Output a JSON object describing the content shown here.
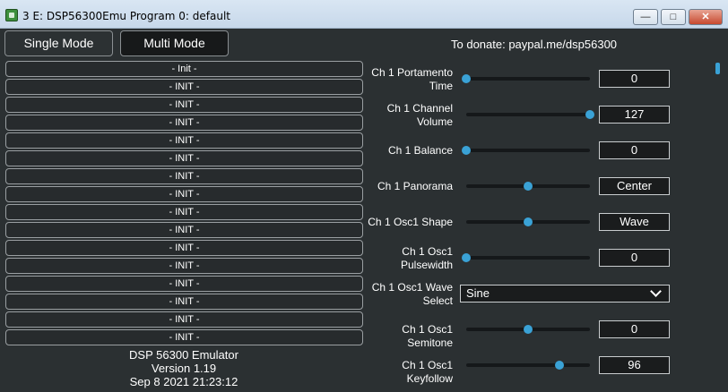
{
  "window": {
    "title": "3 E: DSP56300Emu Program 0: default",
    "minimize": "—",
    "maximize": "□",
    "close": "✕"
  },
  "modes": {
    "single": "Single Mode",
    "multi": "Multi Mode"
  },
  "donate": "To donate: paypal.me/dsp56300",
  "patches": [
    "- Init -",
    "- INIT -",
    "- INIT -",
    "- INIT -",
    "- INIT -",
    "- INIT -",
    "- INIT -",
    "- INIT -",
    "- INIT -",
    "- INIT -",
    "- INIT -",
    "- INIT -",
    "- INIT -",
    "- INIT -",
    "- INIT -",
    "- INIT -"
  ],
  "footer": {
    "name": "DSP 56300 Emulator",
    "version": "Version 1.19",
    "date": "Sep  8 2021 21:23:12"
  },
  "params": [
    {
      "label": "Ch 1 Portamento Time",
      "value": "0",
      "level": 0.0
    },
    {
      "label": "Ch 1 Channel Volume",
      "value": "127",
      "level": 1.0
    },
    {
      "label": "Ch 1 Balance",
      "value": "0",
      "level": 0.0
    },
    {
      "label": "Ch 1 Panorama",
      "value": "Center",
      "level": 0.5
    },
    {
      "label": "Ch 1 Osc1 Shape",
      "value": "Wave",
      "level": 0.5
    },
    {
      "label": "Ch 1 Osc1 Pulsewidth",
      "value": "0",
      "level": 0.0
    },
    {
      "label": "Ch 1 Osc1 Wave Select",
      "value": "Sine"
    },
    {
      "label": "Ch 1 Osc1 Semitone",
      "value": "0",
      "level": 0.5
    },
    {
      "label": "Ch 1 Osc1 Keyfollow",
      "value": "96",
      "level": 0.75
    }
  ],
  "colors": {
    "accent": "#3aa2d6",
    "background": "#2b3032"
  }
}
